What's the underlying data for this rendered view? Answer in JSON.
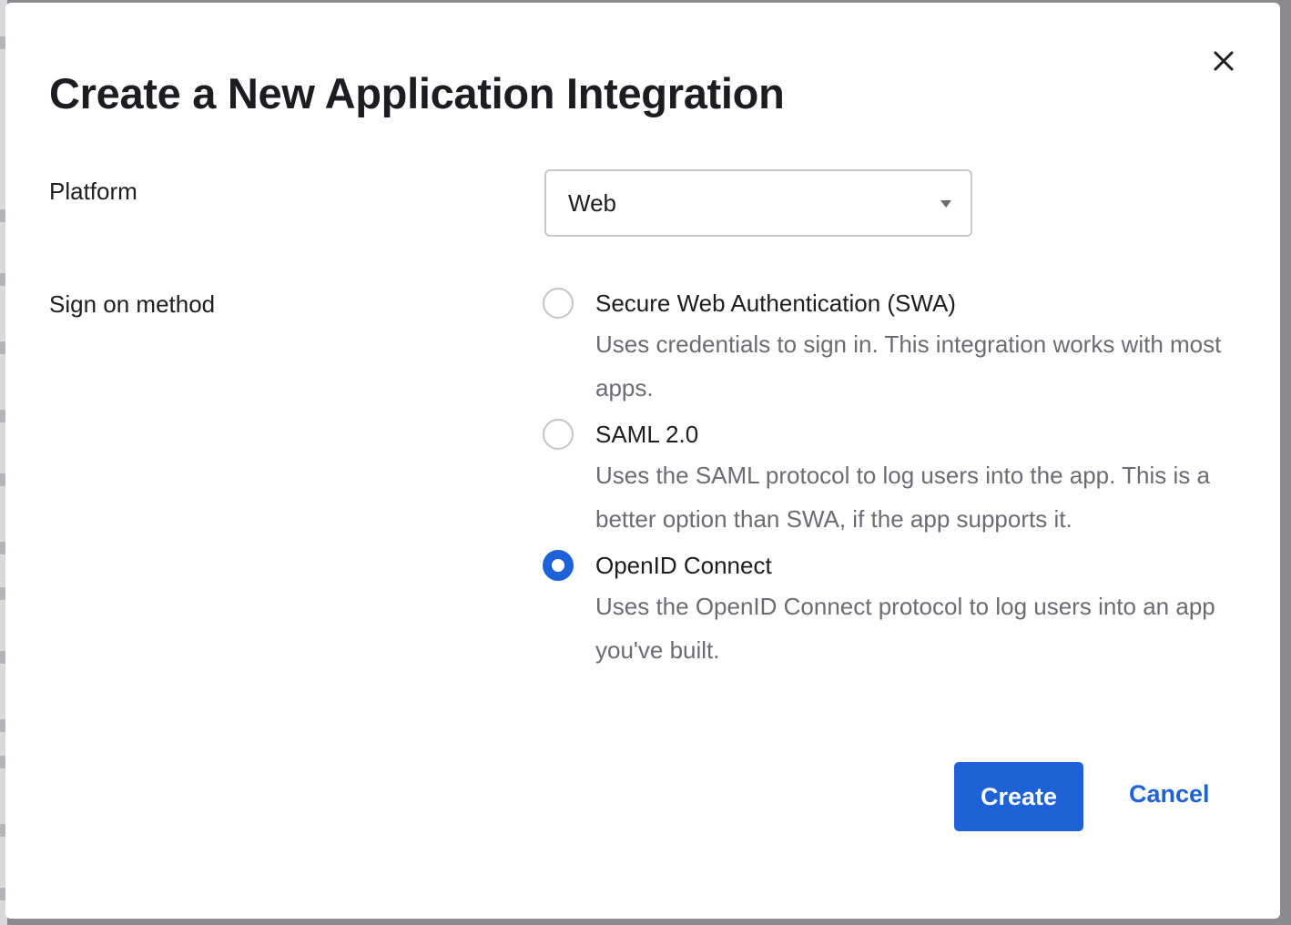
{
  "dialog": {
    "title": "Create a New Application Integration",
    "close_icon": "close-icon"
  },
  "platform": {
    "label": "Platform",
    "selected": "Web",
    "caret_icon": "caret-down-icon"
  },
  "sign_on": {
    "label": "Sign on method",
    "options": [
      {
        "title": "Secure Web Authentication (SWA)",
        "description": "Uses credentials to sign in. This integration works with most apps.",
        "checked": false
      },
      {
        "title": "SAML 2.0",
        "description": "Uses the SAML protocol to log users into the app. This is a better option than SWA, if the app supports it.",
        "checked": false
      },
      {
        "title": "OpenID Connect",
        "description": "Uses the OpenID Connect protocol to log users into an app you've built.",
        "checked": true
      }
    ]
  },
  "actions": {
    "create_label": "Create",
    "cancel_label": "Cancel"
  },
  "colors": {
    "accent": "#1e62d8",
    "text": "#1d1d21",
    "muted_text": "#6b6b73",
    "border": "#c8c8cc"
  }
}
